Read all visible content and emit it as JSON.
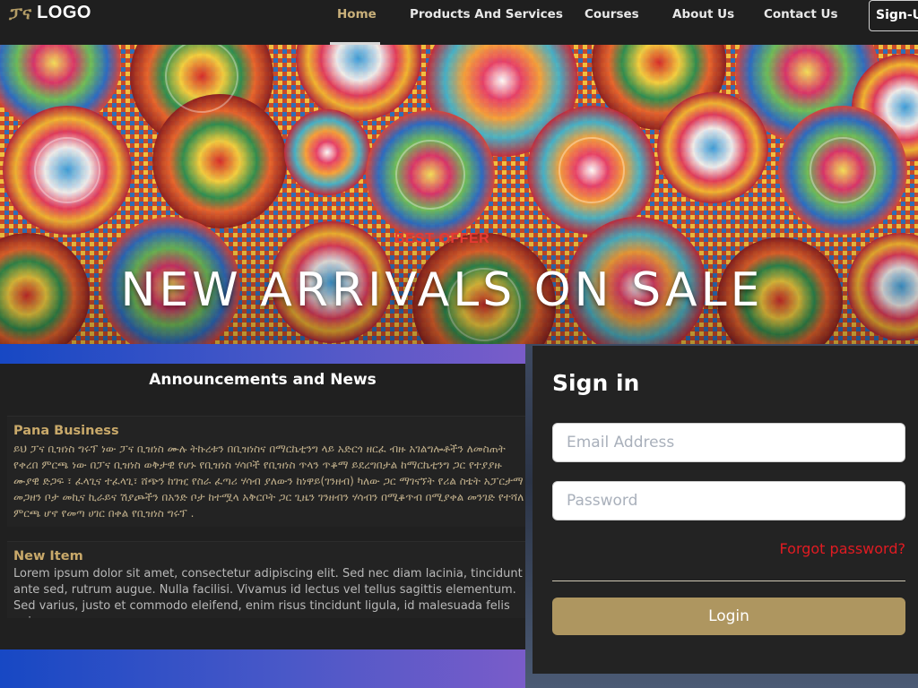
{
  "nav": {
    "logo_glyph": "ፓና",
    "logo_text": "LOGO",
    "links": [
      "Home",
      "Products And Services",
      "Courses",
      "About Us",
      "Contact Us"
    ],
    "signup_label": "Sign-Up"
  },
  "hero": {
    "kicker": "BEST OFFER",
    "title": "NEW ARRIVALS ON SALE"
  },
  "news": {
    "heading": "Announcements and News",
    "items": [
      {
        "title": "Pana Business",
        "body": "ይህ ፓና ቢዝነስ ግሩፕ ነው ፓና ቢዝነስ ሙሉ ትኩረቱን በቢዝነስና በማርኬቲንግ ላይ አድርጎ ዘርፈ ብዙ አገልግሎቶችን ለመስጠት የቀረበ ምርጫ ነው በፓና ቢዝነስ ወቅታዊ የሆኑ የቢዝነስ ሃሳቦች የቢዝነስ ጥላን ጥቆማ ይደረግበታል ከማርኬቲንግ ጋር የተያያዙ ሙያዊ ድጋፍ ፣ ፈላጊና ተፈላጊ፣ ሸጭን ከገዢ የስራ ፈጣሪ ሃሳብ ያለውን ከነዋይ(ገንዘብ) ካለው ጋር ማገናኘት የሪል ስቴት አፓርታማ መጋዘን ቦታ መኪና ኪራይና ሽያጮችን በአንድ ቦታ ከተሟላ አቅርቦት ጋር ጊዜን ገንዘብን ሃሳብን በሚቆጥብ በሚያቀል መንገድ የተሻለ ምርጫ ሆኖ የመጣ ሀገር በቀል የቢዝነስ ግሩፕ ."
      },
      {
        "title": "New Item",
        "body": "Lorem ipsum dolor sit amet, consectetur adipiscing elit. Sed nec diam lacinia, tincidunt ante sed, rutrum augue. Nulla facilisi. Vivamus id lectus vel tellus sagittis elementum. Sed varius, justo et commodo eleifend, enim risus tincidunt ligula, id malesuada felis enim a"
      }
    ]
  },
  "signin": {
    "title": "Sign in",
    "email_placeholder": "Email Address",
    "password_placeholder": "Password",
    "forgot": "Forgot password?",
    "login_label": "Login"
  },
  "colors": {
    "accent_gold": "#ae9660",
    "active_nav": "#c9b07a",
    "offer_red": "#e83a32",
    "forgot_red": "#e11b22"
  }
}
